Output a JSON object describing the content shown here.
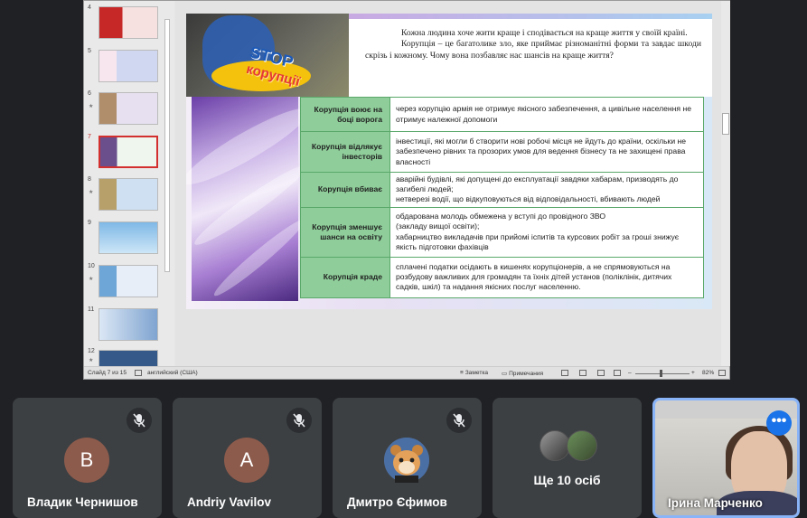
{
  "slides": [
    {
      "number": "4",
      "theme": "#c62828"
    },
    {
      "number": "5",
      "theme": "#7b8fc6"
    },
    {
      "number": "6",
      "theme": "#b08e6b"
    },
    {
      "number": "7",
      "theme": "#6a4f8c",
      "active": true
    },
    {
      "number": "8",
      "theme": "#8ab0d8"
    },
    {
      "number": "9",
      "theme": "#7fb8e6"
    },
    {
      "number": "10",
      "theme": "#6ea6d8"
    },
    {
      "number": "11",
      "theme": "#7fa4d0"
    },
    {
      "number": "12",
      "theme": "#355a8a"
    }
  ],
  "slide": {
    "stop_word": "STOP",
    "stop_word2": "корупції",
    "intro_1": "Кожна людина хоче жити краще і сподівається на краще життя у своїй країні.",
    "intro_2": "Корупція – це багатолике зло, яке приймає різноманітні форми та завдає шкоди скрізь і кожному. Чому вона позбавляє нас шансів на краще життя?",
    "rows": [
      {
        "head": "Корупція воює на боці ворога",
        "body": "через корупцію армія не отримує якісного забезпечення,  а цивільне населення не отримує належної допомоги"
      },
      {
        "head": "Корупція відлякує інвесторів",
        "body": "інвестиції, які могли б створити нові робочі місця не йдуть до країни, оскільки не забезпечено рівних та прозорих умов для ведення бізнесу та не захищені права власності"
      },
      {
        "head": "Корупція вбиває",
        "body": "аварійні будівлі, які допущені до експлуатації завдяки хабарам, призводять до загибелі людей;\nнетверезі водії, що відкуповуються від відповідальності, вбивають людей"
      },
      {
        "head": "Корупція зменшує шанси на освіту",
        "body": "обдарована молодь обмежена у вступі до провідного ЗВО\n(закладу вищої освіти);\nхабарництво викладачів при прийомі іспитів та курсових робіт за гроші знижує якість підготовки фахівців"
      },
      {
        "head": "Корупція краде",
        "body": "сплачені податки осідають в кишенях корупціонерів, а не спрямовуються на розбудову важливих для громадян та їхніх дітей установ (поліклінік, дитячих садків, шкіл) та надання якісних послуг населенню."
      }
    ]
  },
  "statusbar": {
    "slide_info": "Слайд 7 из 15",
    "language": "английский (США)",
    "notes": "Заметка",
    "comments": "Примечания",
    "zoom": "82%"
  },
  "participants": [
    {
      "initial": "B",
      "name": "Владик Чернишов",
      "avatar_color": "#8d5b4c",
      "muted": true
    },
    {
      "initial": "A",
      "name": "Andriy Vavilov",
      "avatar_color": "#8d5b4c",
      "muted": true
    },
    {
      "initial": "",
      "name": "Дмитро Єфимов",
      "avatar_color": "#5f6368",
      "muted": true
    }
  ],
  "more_people": "Ще 10 осіб",
  "self_name": "Ірина Марченко"
}
